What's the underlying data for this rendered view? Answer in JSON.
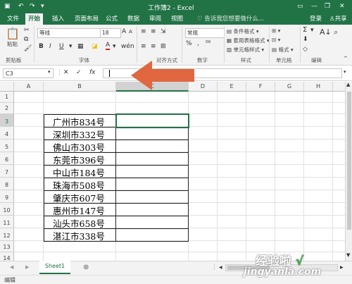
{
  "window": {
    "title": "工作簿2 - Excel"
  },
  "tabs": [
    "文件",
    "开始",
    "插入",
    "页面布局",
    "公式",
    "数据",
    "审阅",
    "视图"
  ],
  "active_tab": "开始",
  "tell_me": "告诉我您想要做什么...",
  "account": {
    "login": "登录",
    "share": "共享"
  },
  "ribbon": {
    "clipboard": {
      "paste": "粘贴",
      "label": "剪贴板"
    },
    "font": {
      "name": "等线",
      "size": "18",
      "bold": "B",
      "italic": "I",
      "underline": "U",
      "font_color": "A",
      "grow": "A",
      "shrink": "A",
      "label": "字体"
    },
    "alignment": {
      "label": "对齐方式"
    },
    "number": {
      "format": "常规",
      "label": "数字"
    },
    "styles": {
      "conditional": "条件格式",
      "table": "套用表格格式",
      "cell": "单元格样式",
      "label": "样式"
    },
    "cells": {
      "format": "格式",
      "label": "单元格"
    },
    "editing": {
      "sum": "Σ",
      "label": "编辑"
    }
  },
  "formula_bar": {
    "name_box": "C3",
    "cancel": "✕",
    "enter": "✓",
    "fx": "fx",
    "value": ""
  },
  "columns": [
    "A",
    "B",
    "C",
    "D",
    "E",
    "F",
    "G",
    "H"
  ],
  "selected_column": "C",
  "rows": [
    "1",
    "2",
    "3",
    "4",
    "5",
    "6",
    "7",
    "8",
    "9",
    "10",
    "11",
    "12",
    "13",
    "14",
    "15"
  ],
  "selected_row": "3",
  "cells_b": [
    "广州市834号",
    "深圳市332号",
    "佛山市303号",
    "东莞市396号",
    "中山市184号",
    "珠海市508号",
    "肇庆市607号",
    "惠州市147号",
    "汕头市658号",
    "湛江市338号"
  ],
  "sheet_tabs": [
    "Sheet1"
  ],
  "status": "编辑",
  "watermark": {
    "line1": "经验啦",
    "check": "√",
    "line2": "jingyanla.com"
  },
  "colors": {
    "excel_green": "#217346",
    "arrow": "#e0673f"
  }
}
